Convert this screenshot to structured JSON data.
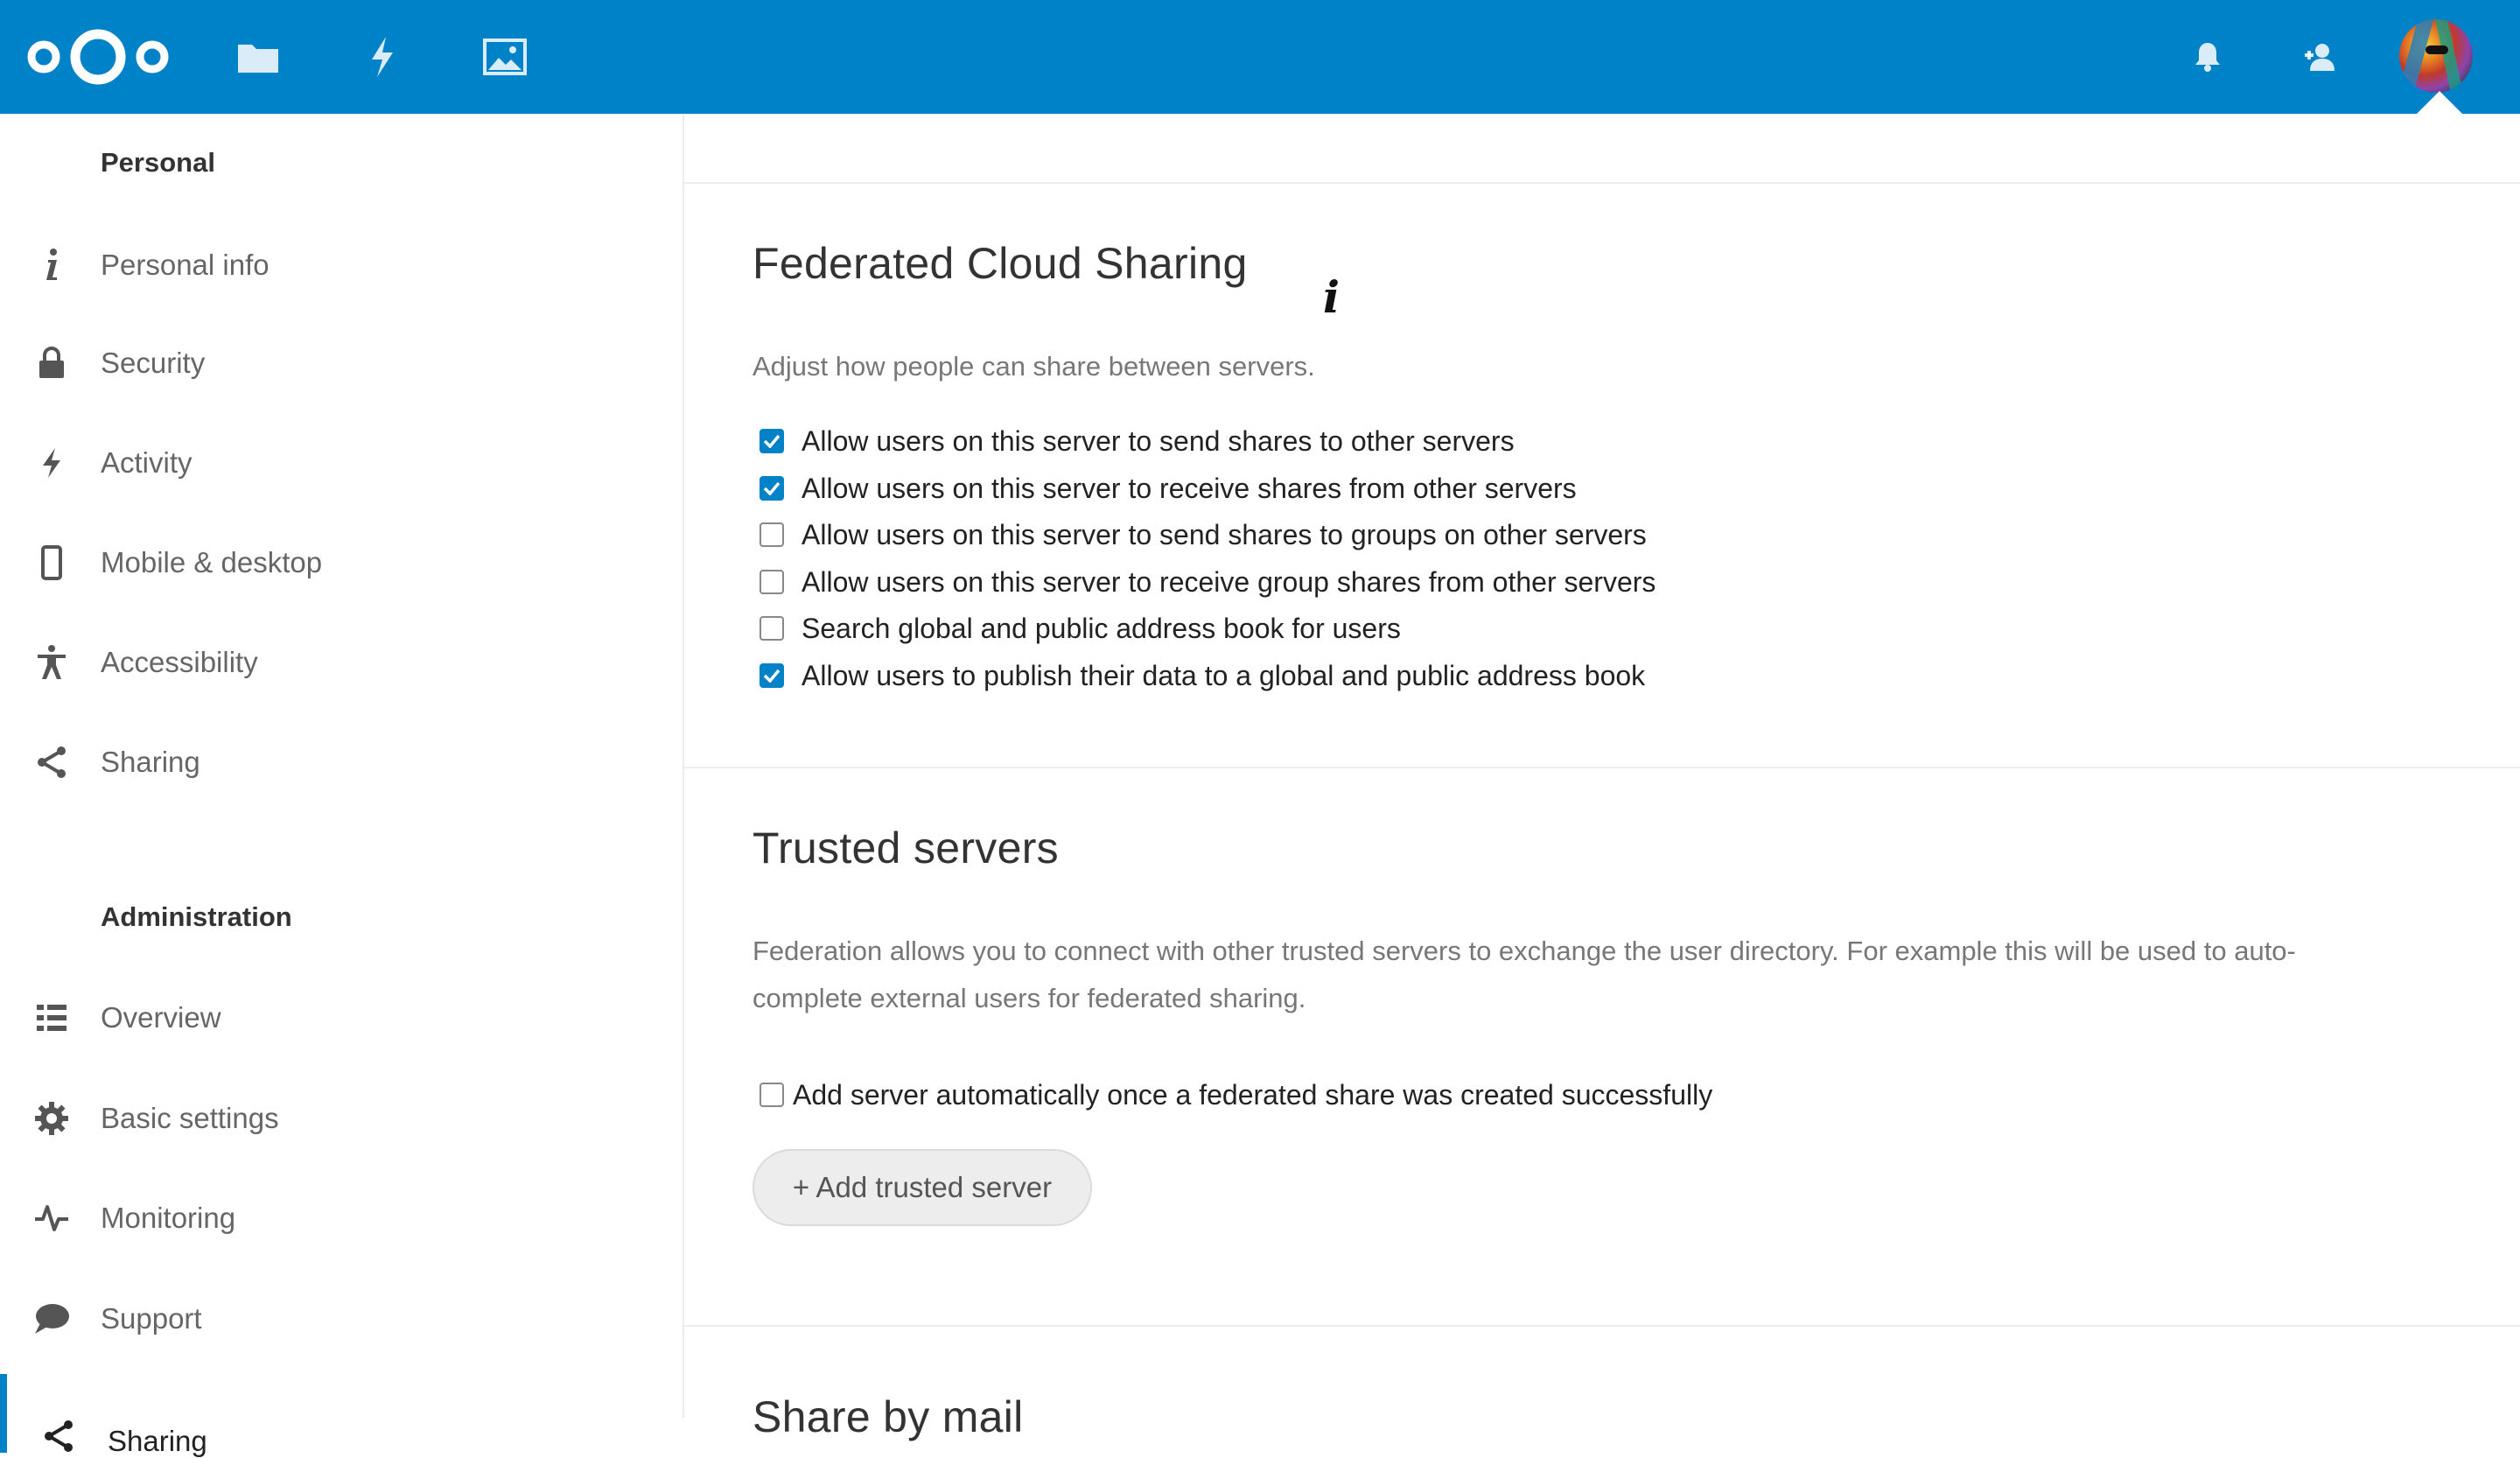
{
  "header": {
    "apps": [
      {
        "name": "Files",
        "icon": "folder-icon"
      },
      {
        "name": "Activity",
        "icon": "lightning-icon"
      },
      {
        "name": "Photos",
        "icon": "image-icon"
      }
    ],
    "right_icons": [
      "bell-icon",
      "contacts-icon"
    ],
    "accent": "#0082c9"
  },
  "sidebar": {
    "personal_heading": "Personal",
    "personal_items": [
      {
        "label": "Personal info",
        "icon": "info-icon"
      },
      {
        "label": "Security",
        "icon": "lock-icon"
      },
      {
        "label": "Activity",
        "icon": "lightning-icon"
      },
      {
        "label": "Mobile & desktop",
        "icon": "phone-icon"
      },
      {
        "label": "Accessibility",
        "icon": "accessibility-icon"
      },
      {
        "label": "Sharing",
        "icon": "share-icon"
      }
    ],
    "admin_heading": "Administration",
    "admin_items": [
      {
        "label": "Overview",
        "icon": "list-icon"
      },
      {
        "label": "Basic settings",
        "icon": "gear-icon"
      },
      {
        "label": "Monitoring",
        "icon": "pulse-icon"
      },
      {
        "label": "Support",
        "icon": "chat-icon"
      },
      {
        "label": "Sharing",
        "icon": "share-icon",
        "active": true
      }
    ]
  },
  "federated": {
    "title": "Federated Cloud Sharing",
    "description": "Adjust how people can share between servers.",
    "options": [
      {
        "label": "Allow users on this server to send shares to other servers",
        "checked": true
      },
      {
        "label": "Allow users on this server to receive shares from other servers",
        "checked": true
      },
      {
        "label": "Allow users on this server to send shares to groups on other servers",
        "checked": false
      },
      {
        "label": "Allow users on this server to receive group shares from other servers",
        "checked": false
      },
      {
        "label": "Search global and public address book for users",
        "checked": false
      },
      {
        "label": "Allow users to publish their data to a global and public address book",
        "checked": true
      }
    ]
  },
  "trusted": {
    "title": "Trusted servers",
    "description_line1": "Federation allows you to connect with other trusted servers to exchange the user directory. For example this will be used to auto-",
    "description_line2": "complete external users for federated sharing.",
    "auto_add_label": "Add server automatically once a federated share was created successfully",
    "auto_add_checked": false,
    "add_button": "+ Add trusted server"
  },
  "next_section": {
    "title": "Share by mail"
  }
}
